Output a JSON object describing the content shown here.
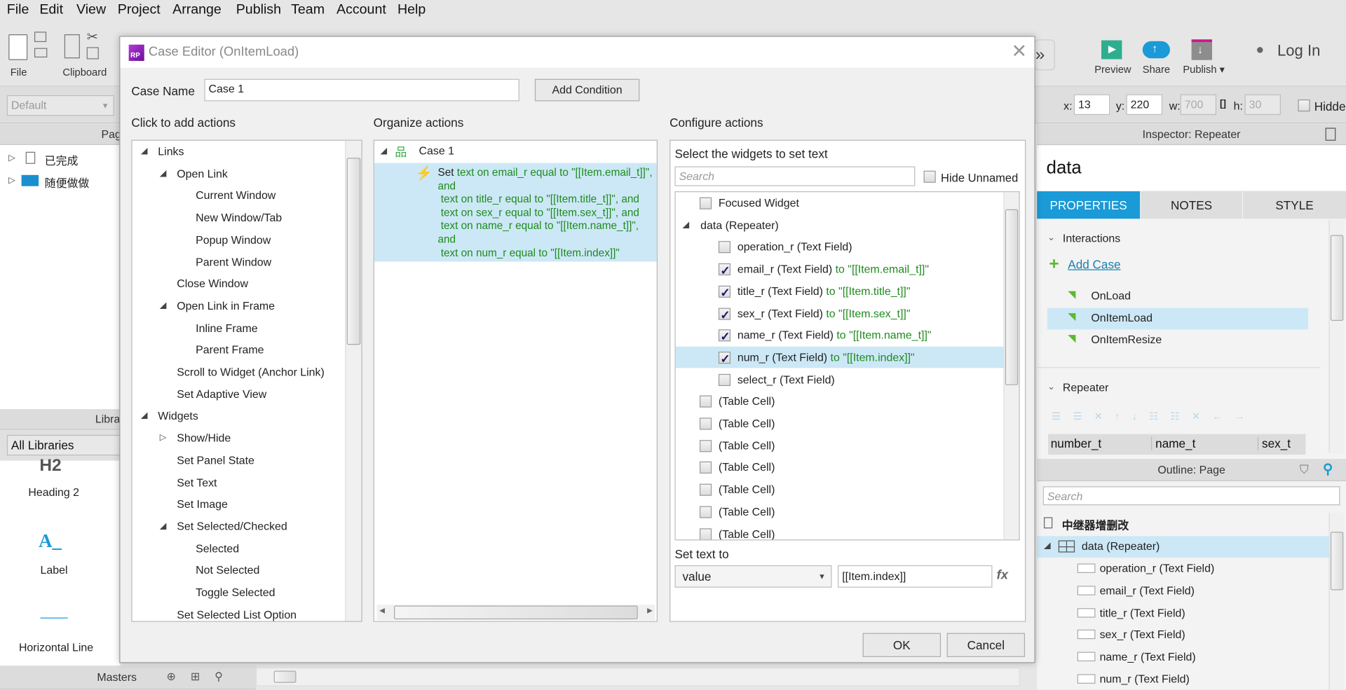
{
  "menu": [
    "File",
    "Edit",
    "View",
    "Project",
    "Arrange",
    "Publish",
    "Team",
    "Account",
    "Help"
  ],
  "toolbar": {
    "file": "File",
    "clipboard": "Clipboard",
    "preview": "Preview",
    "share": "Share",
    "publish": "Publish ▾",
    "login": "Log In"
  },
  "format": {
    "style_select": "Default",
    "x_label": "x:",
    "x": "13",
    "y_label": "y:",
    "y": "220",
    "w_label": "w:",
    "w": "700",
    "h_label": "h:",
    "h": "30",
    "hidden": "Hidden"
  },
  "pages": {
    "header": "Pages",
    "items": [
      "已完成",
      "随便做做"
    ]
  },
  "libraries": {
    "header": "Libraries",
    "select": "All Libraries",
    "widgets": [
      "Heading 2",
      "Label",
      "Horizontal Line"
    ]
  },
  "masters": {
    "header": "Masters"
  },
  "dialog": {
    "title": "Case Editor (OnItemLoad)",
    "case_name_label": "Case Name",
    "case_name": "Case 1",
    "add_condition": "Add Condition",
    "col1_title": "Click to add actions",
    "col2_title": "Organize actions",
    "col3_title": "Configure actions",
    "actions": [
      {
        "label": "Links",
        "level": 0,
        "tree": "open"
      },
      {
        "label": "Open Link",
        "level": 1,
        "tree": "open"
      },
      {
        "label": "Current Window",
        "level": 2
      },
      {
        "label": "New Window/Tab",
        "level": 2
      },
      {
        "label": "Popup Window",
        "level": 2
      },
      {
        "label": "Parent Window",
        "level": 2
      },
      {
        "label": "Close Window",
        "level": 1
      },
      {
        "label": "Open Link in Frame",
        "level": 1,
        "tree": "open"
      },
      {
        "label": "Inline Frame",
        "level": 2
      },
      {
        "label": "Parent Frame",
        "level": 2
      },
      {
        "label": "Scroll to Widget (Anchor Link)",
        "level": 1
      },
      {
        "label": "Set Adaptive View",
        "level": 1
      },
      {
        "label": "Widgets",
        "level": 0,
        "tree": "open"
      },
      {
        "label": "Show/Hide",
        "level": 1,
        "tree": "closed"
      },
      {
        "label": "Set Panel State",
        "level": 1
      },
      {
        "label": "Set Text",
        "level": 1
      },
      {
        "label": "Set Image",
        "level": 1
      },
      {
        "label": "Set Selected/Checked",
        "level": 1,
        "tree": "open"
      },
      {
        "label": "Selected",
        "level": 2
      },
      {
        "label": "Not Selected",
        "level": 2
      },
      {
        "label": "Toggle Selected",
        "level": 2
      },
      {
        "label": "Set Selected List Option",
        "level": 1
      }
    ],
    "case_label": "Case 1",
    "action_set": "Set",
    "action_lines": [
      "text on email_r equal to \"[[Item.email_t]]\",",
      "and",
      " text on title_r equal to \"[[Item.title_t]]\", and",
      " text on sex_r equal to \"[[Item.sex_t]]\", and",
      " text on name_r equal to \"[[Item.name_t]]\",",
      "and",
      " text on num_r equal to \"[[Item.index]]\""
    ],
    "select_widgets_label": "Select the widgets to set text",
    "search_placeholder": "Search",
    "hide_unnamed": "Hide Unnamed",
    "widgets": [
      {
        "label": "Focused Widget",
        "level": 1,
        "checked": false
      },
      {
        "label": "data (Repeater)",
        "level": 0,
        "tree": "open"
      },
      {
        "label": "operation_r (Text Field)",
        "level": 2,
        "checked": false
      },
      {
        "label": "email_r (Text Field)",
        "level": 2,
        "checked": true,
        "to": " to \"[[Item.email_t]]\""
      },
      {
        "label": "title_r (Text Field)",
        "level": 2,
        "checked": true,
        "to": " to \"[[Item.title_t]]\""
      },
      {
        "label": "sex_r (Text Field)",
        "level": 2,
        "checked": true,
        "to": " to \"[[Item.sex_t]]\""
      },
      {
        "label": "name_r (Text Field)",
        "level": 2,
        "checked": true,
        "to": " to \"[[Item.name_t]]\""
      },
      {
        "label": "num_r (Text Field)",
        "level": 2,
        "checked": true,
        "to": " to \"[[Item.index]]\"",
        "selected": true
      },
      {
        "label": "select_r (Text Field)",
        "level": 2,
        "checked": false
      },
      {
        "label": "(Table Cell)",
        "level": 1,
        "checked": false
      },
      {
        "label": "(Table Cell)",
        "level": 1,
        "checked": false
      },
      {
        "label": "(Table Cell)",
        "level": 1,
        "checked": false
      },
      {
        "label": "(Table Cell)",
        "level": 1,
        "checked": false
      },
      {
        "label": "(Table Cell)",
        "level": 1,
        "checked": false
      },
      {
        "label": "(Table Cell)",
        "level": 1,
        "checked": false
      },
      {
        "label": "(Table Cell)",
        "level": 1,
        "checked": false
      }
    ],
    "set_text_to_label": "Set text to",
    "set_text_type": "value",
    "set_text_value": "[[Item.index]]",
    "fx": "fx",
    "ok": "OK",
    "cancel": "Cancel"
  },
  "inspector": {
    "header": "Inspector: Repeater",
    "name": "data",
    "tabs": [
      "PROPERTIES",
      "NOTES",
      "STYLE"
    ],
    "interactions": "Interactions",
    "add_case": "Add Case",
    "events": [
      "OnLoad",
      "OnItemLoad",
      "OnItemResize"
    ],
    "repeater": "Repeater",
    "columns": [
      "number_t",
      "name_t",
      "sex_t"
    ]
  },
  "outline": {
    "header": "Outline: Page",
    "search_placeholder": "Search",
    "page": "中继器增删改",
    "repeater": "data (Repeater)",
    "items": [
      "operation_r (Text Field)",
      "email_r (Text Field)",
      "title_r (Text Field)",
      "sex_r (Text Field)",
      "name_r (Text Field)",
      "num_r (Text Field)"
    ]
  },
  "colors": {
    "accent": "#1a9ad6",
    "selection": "#cce8f6",
    "action_text": "#1e8b1e",
    "brand": "#8e1fb5"
  }
}
